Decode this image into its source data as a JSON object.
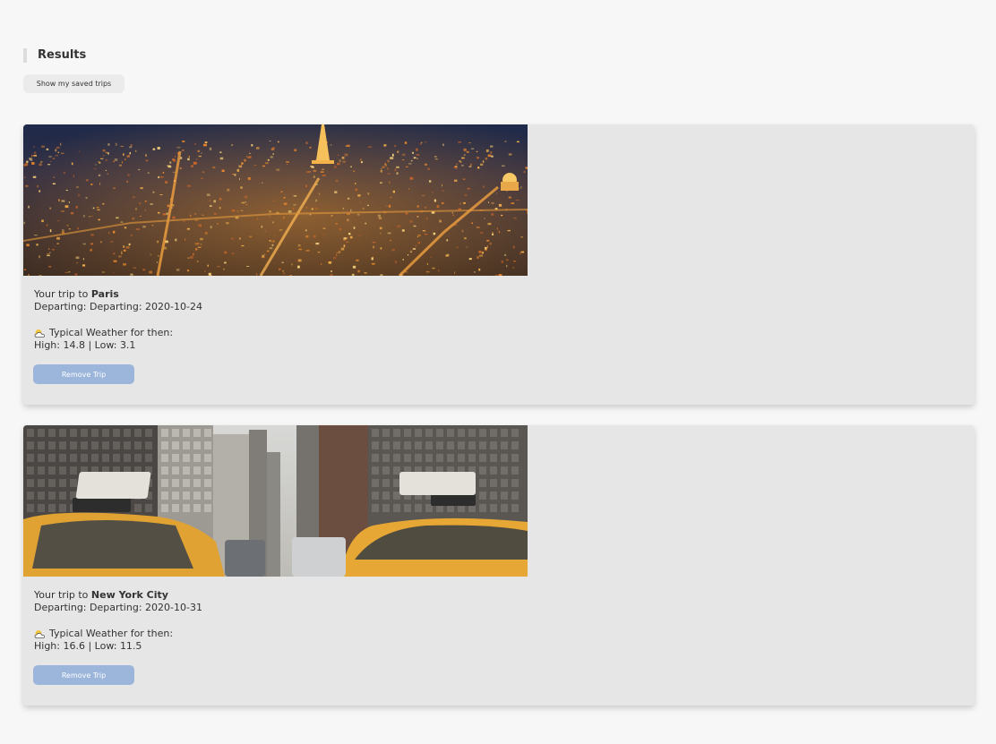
{
  "header": {
    "title": "Results",
    "saved_trips_label": "Show my saved trips"
  },
  "trips": [
    {
      "prefix": "Your trip to",
      "destination": "Paris",
      "departing": "Departing: Departing: 2020-10-24",
      "weather_title": "Typical Weather for then:",
      "weather_icon": "partly-cloudy-icon",
      "temps": "High: 14.8 | Low: 3.1",
      "remove_label": "Remove Trip"
    },
    {
      "prefix": "Your trip to",
      "destination": "New York City",
      "departing": "Departing: Departing: 2020-10-31",
      "weather_title": "Typical Weather for then:",
      "weather_icon": "partly-cloudy-icon",
      "temps": "High: 16.6 | Low: 11.5",
      "remove_label": "Remove Trip"
    }
  ],
  "colors": {
    "background": "#f7f7f7",
    "card": "#e6e6e6",
    "remove_button": "#9cb5da",
    "saved_button": "#ebebeb"
  }
}
